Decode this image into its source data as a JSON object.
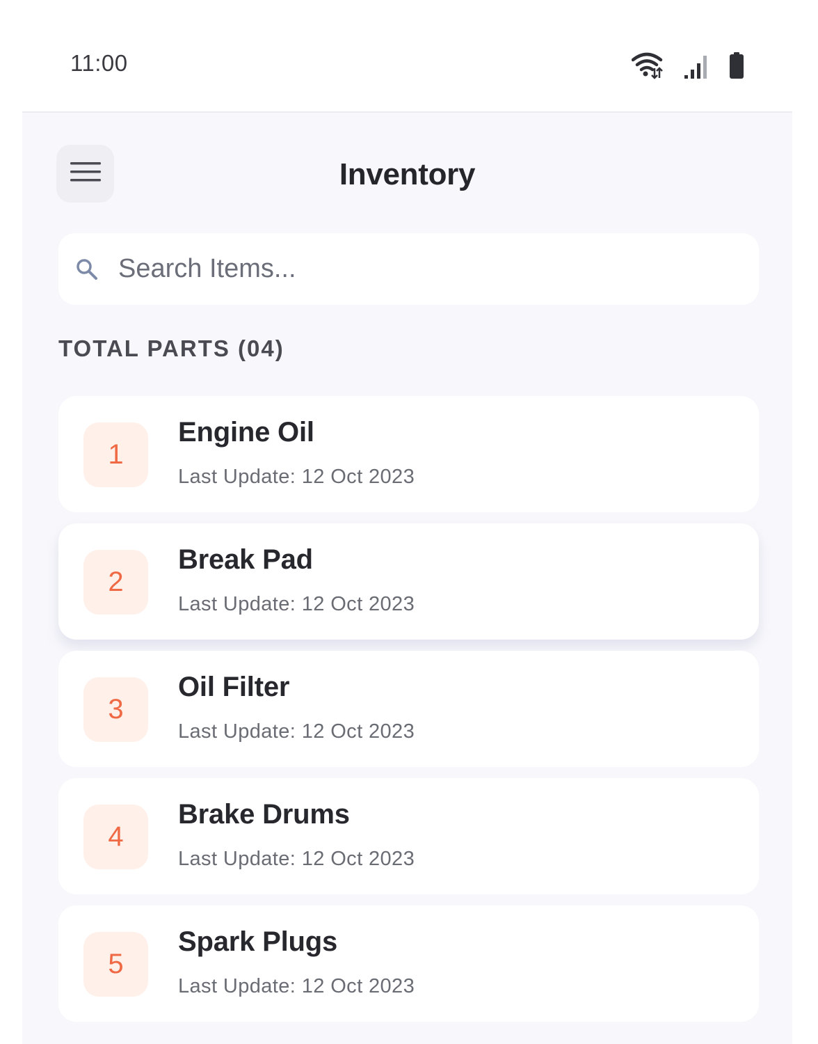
{
  "status_bar": {
    "time": "11:00",
    "icons": [
      "wifi-icon",
      "cellular-signal-icon",
      "battery-icon"
    ]
  },
  "header": {
    "title": "Inventory",
    "menu_icon": "hamburger-menu-icon"
  },
  "search": {
    "placeholder": "Search Items...",
    "value": ""
  },
  "section": {
    "heading": "TOTAL PARTS (04)"
  },
  "parts": [
    {
      "index": "1",
      "name": "Engine Oil",
      "updated": "Last Update: 12 Oct 2023"
    },
    {
      "index": "2",
      "name": "Break Pad",
      "updated": "Last Update: 12 Oct 2023"
    },
    {
      "index": "3",
      "name": "Oil Filter",
      "updated": "Last Update: 12 Oct 2023"
    },
    {
      "index": "4",
      "name": "Brake Drums",
      "updated": "Last Update: 12 Oct 2023"
    },
    {
      "index": "5",
      "name": "Spark Plugs",
      "updated": "Last Update: 12 Oct 2023"
    }
  ],
  "colors": {
    "accent": "#ef6a44",
    "badge_background": "#fff0ea",
    "screen_background": "#f8f8fc",
    "card_background": "#ffffff"
  }
}
